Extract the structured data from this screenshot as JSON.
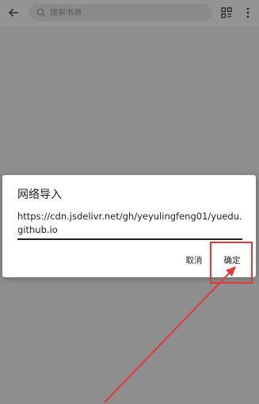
{
  "appbar": {
    "back_icon": "arrow-left-icon",
    "search_placeholder": "搜索书源",
    "search_icon": "search-icon",
    "grid_icon": "grid-icon",
    "more_icon": "more-vertical-icon"
  },
  "dialog": {
    "title": "网络导入",
    "input_value": "https://cdn.jsdelivr.net/gh/yeyulingfeng01/yuedu.github.io",
    "cancel_label": "取消",
    "ok_label": "确定"
  },
  "annotation": {
    "color": "#e53935"
  }
}
